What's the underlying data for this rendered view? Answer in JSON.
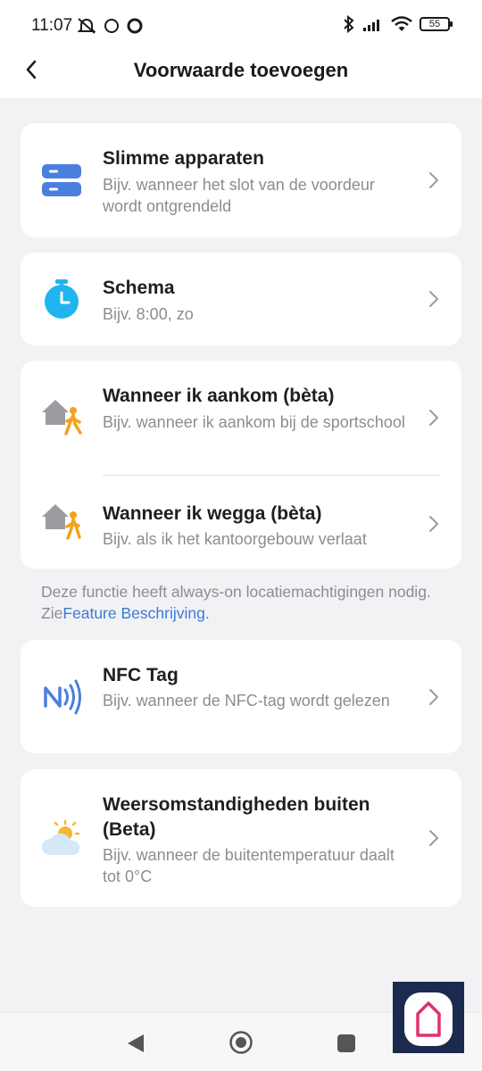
{
  "status_bar": {
    "time": "11:07",
    "battery": "55"
  },
  "header": {
    "title": "Voorwaarde toevoegen"
  },
  "items": {
    "smart_devices": {
      "title": "Slimme apparaten",
      "desc": "Bijv. wanneer het slot van de voordeur wordt ontgrendeld",
      "icon": "smart-devices-icon"
    },
    "schedule": {
      "title": "Schema",
      "desc": "Bijv. 8:00, zo",
      "icon": "timer-icon"
    },
    "arrive": {
      "title": "Wanneer ik aankom (bèta)",
      "desc": "Bijv. wanneer ik aankom bij de sportschool",
      "icon": "home-arrive-icon"
    },
    "leave": {
      "title": "Wanneer ik wegga (bèta)",
      "desc": "Bijv. als ik het kantoorgebouw verlaat",
      "icon": "home-leave-icon"
    },
    "nfc": {
      "title": "NFC Tag",
      "desc": "Bijv. wanneer de NFC-tag wordt gelezen",
      "icon": "nfc-icon"
    },
    "weather": {
      "title": "Weersomstandigheden buiten (Beta)",
      "desc": "Bijv. wanneer de buitentemperatuur daalt tot 0°C",
      "icon": "weather-icon"
    }
  },
  "note": {
    "text": "Deze functie heeft always-on locatiemachtigingen nodig. Zie",
    "link": "Feature Beschrijving."
  },
  "colors": {
    "accent_blue": "#3a7bd5",
    "device_blue": "#4a7fe0",
    "timer_cyan": "#1fb6f0",
    "person_orange": "#f2a21d",
    "house_gray": "#9a9ca0",
    "background": "#f2f2f4"
  }
}
